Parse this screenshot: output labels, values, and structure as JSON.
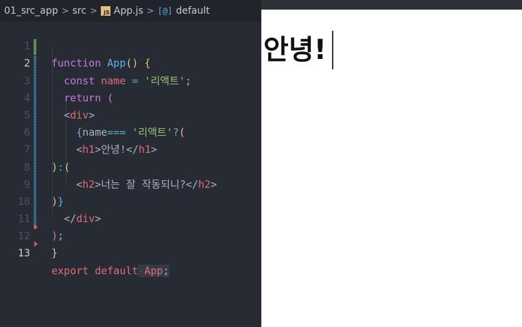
{
  "breadcrumb": {
    "folder": "01_src_app",
    "subfolder": "src",
    "file_icon": "JS",
    "file": "App.js",
    "symbol_icon": "[@]",
    "symbol": "default",
    "separator": ">"
  },
  "line_numbers": [
    "1",
    "2",
    "3",
    "4",
    "5",
    "6",
    "7",
    "8",
    "9",
    "10",
    "11",
    "12",
    "13"
  ],
  "code": {
    "l1": {
      "kw": "function",
      "sp1": " ",
      "fn": "App",
      "paren": "()",
      "sp2": " ",
      "brace": "{"
    },
    "l2": {
      "indent": "  ",
      "kw": "const",
      "sp1": " ",
      "var": "name",
      "sp2": " ",
      "op": "=",
      "sp3": " ",
      "str": "'리액트'",
      "end": ";"
    },
    "l3": {
      "indent": "  ",
      "kw": "return",
      "sp1": " ",
      "paren": "("
    },
    "l4": {
      "indent": "  ",
      "open": "<",
      "tag": "div",
      "close": ">"
    },
    "l5": {
      "indent": "    ",
      "brace": "{",
      "var": "name",
      "op": "===",
      "sp1": " ",
      "str": "'리액트'",
      "q": "?",
      "paren": "("
    },
    "l6": {
      "indent": "    ",
      "open": "<",
      "tag": "h1",
      "close": ">",
      "text": "안녕!",
      "open2": "</",
      "tag2": "h1",
      "close2": ">"
    },
    "l7": {
      "paren": ")",
      "colon": ":",
      "paren2": "("
    },
    "l8": {
      "indent": "    ",
      "open": "<",
      "tag": "h2",
      "close": ">",
      "text": "너는 잘 작동되니?",
      "open2": "</",
      "tag2": "h2",
      "close2": ">"
    },
    "l9": {
      "paren": ")",
      "brace": "}"
    },
    "l10": {
      "indent": "  ",
      "open": "</",
      "tag": "div",
      "close": ">"
    },
    "l11": {
      "paren": ")",
      "end": ";"
    },
    "l12": {
      "brace": "}"
    },
    "l13": {
      "kw1": "export",
      "sp1": " ",
      "kw2": "default",
      "sp2": "·",
      "fn": "App",
      "end": ";"
    }
  },
  "preview": {
    "heading": "안녕!"
  },
  "colors": {
    "editor_bg": "#272c34",
    "keyword": "#c678dd",
    "function": "#61afef",
    "string": "#98c379",
    "tag": "#e06c75",
    "operator": "#56b6c2",
    "bracket": "#e5c07b"
  }
}
